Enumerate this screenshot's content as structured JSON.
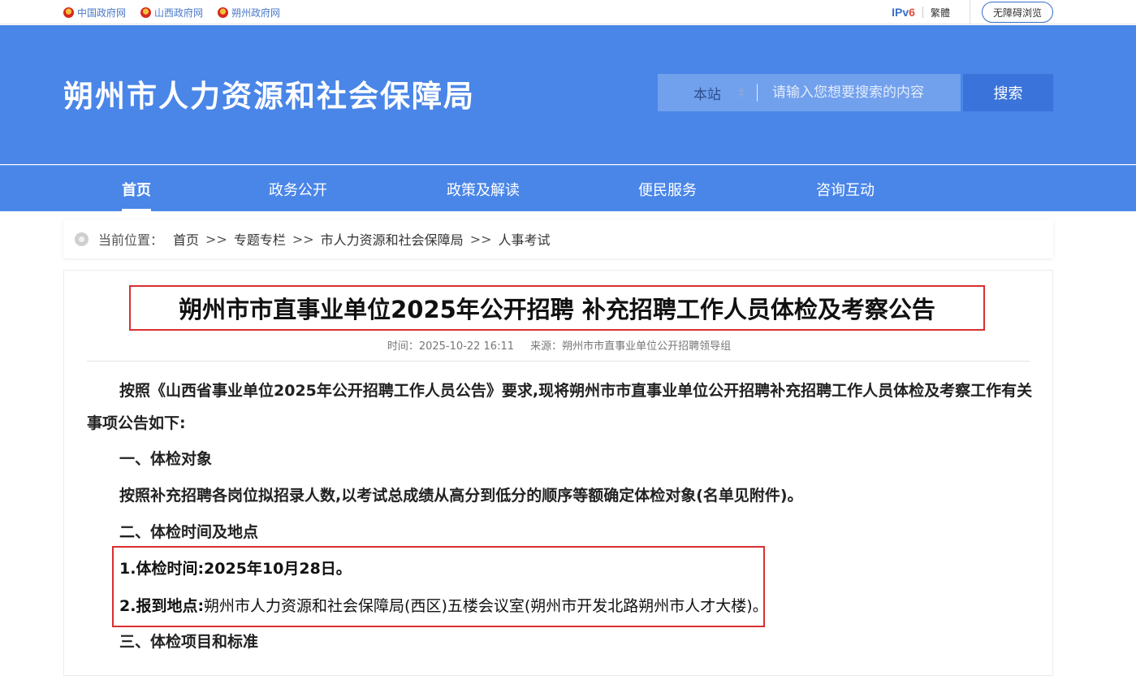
{
  "top_links": [
    "中国政府网",
    "山西政府网",
    "朔州政府网"
  ],
  "top_right": {
    "ipv6_main": "IPv",
    "ipv6_num": "6",
    "traditional": "繁體",
    "accessible": "无障碍浏览"
  },
  "header": {
    "title": "朔州市人力资源和社会保障局"
  },
  "search": {
    "scope": "本站",
    "placeholder": "请输入您想要搜索的内容",
    "button": "搜索"
  },
  "nav": [
    "首页",
    "政务公开",
    "政策及解读",
    "便民服务",
    "咨询互动"
  ],
  "breadcrumb": {
    "label": "当前位置：",
    "items": [
      "首页",
      "专题专栏",
      "市人力资源和社会保障局",
      "人事考试"
    ],
    "sep": ">>"
  },
  "article": {
    "title": "朔州市市直事业单位2025年公开招聘 补充招聘工作人员体检及考察公告",
    "time": "时间：2025-10-22 16:11",
    "source": "来源：朔州市市直事业单位公开招聘领导组",
    "intro": "按照《山西省事业单位2025年公开招聘工作人员公告》要求,现将朔州市市直事业单位公开招聘补充招聘工作人员体检及考察工作有关事项公告如下:",
    "sec1": "一、体检对象",
    "sec1_text": "按照补充招聘各岗位拟招录人数,以考试总成绩从高分到低分的顺序等额确定体检对象(名单见附件)。",
    "sec2": "二、体检时间及地点",
    "item1": "1.体检时间:2025年10月28日。",
    "item2_label": "2.报到地点:",
    "item2_text": "朔州市人力资源和社会保障局(西区)五楼会议室(朔州市开发北路朔州市人才大楼)。",
    "sec3": "三、体检项目和标准"
  }
}
